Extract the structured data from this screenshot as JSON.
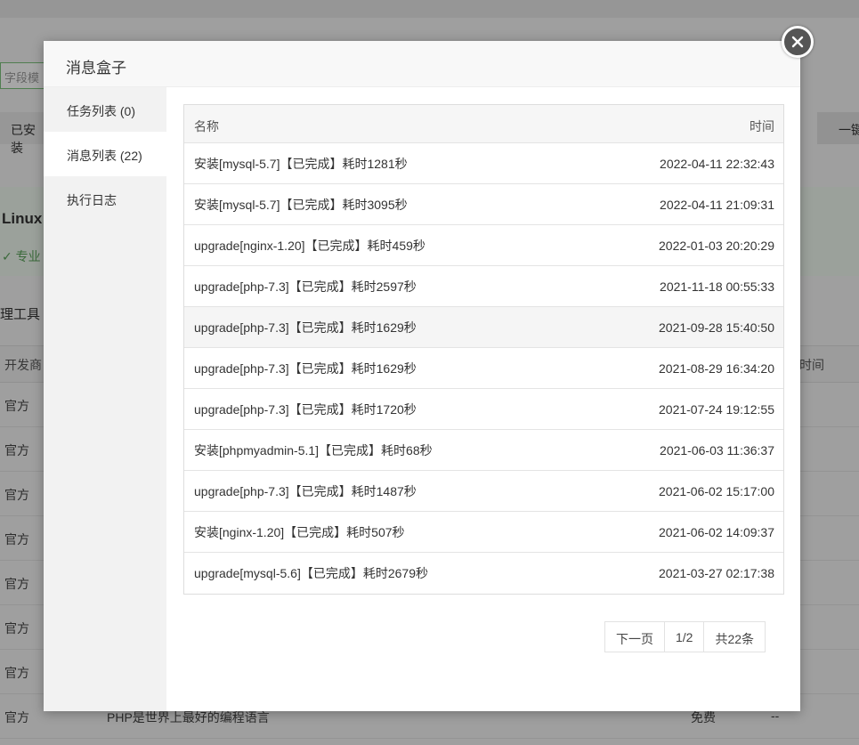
{
  "background": {
    "field_input_placeholder": "字段模",
    "tab_installed": "已安装",
    "onekey_button": "一键",
    "banner_title": "Linux",
    "banner_pro": "✓ 专业",
    "section_title": "理工具",
    "th_vendor": "开发商",
    "th_time": "时间",
    "rows": [
      "官方",
      "官方",
      "官方",
      "官方",
      "官方",
      "官方",
      "官方",
      "官方"
    ],
    "last_row_desc": "PHP是世界上最好的编程语言",
    "last_row_price": "免费",
    "last_row_dash": "--"
  },
  "modal": {
    "title": "消息盒子",
    "sidebar": [
      {
        "label": "任务列表 (0)"
      },
      {
        "label": "消息列表 (22)"
      },
      {
        "label": "执行日志"
      }
    ],
    "table": {
      "col_name": "名称",
      "col_time": "时间",
      "rows": [
        {
          "name": "安装[mysql-5.7]【已完成】耗时1281秒",
          "time": "2022-04-11 22:32:43"
        },
        {
          "name": "安装[mysql-5.7]【已完成】耗时3095秒",
          "time": "2022-04-11 21:09:31"
        },
        {
          "name": "upgrade[nginx-1.20]【已完成】耗时459秒",
          "time": "2022-01-03 20:20:29"
        },
        {
          "name": "upgrade[php-7.3]【已完成】耗时2597秒",
          "time": "2021-11-18 00:55:33"
        },
        {
          "name": "upgrade[php-7.3]【已完成】耗时1629秒",
          "time": "2021-09-28 15:40:50"
        },
        {
          "name": "upgrade[php-7.3]【已完成】耗时1629秒",
          "time": "2021-08-29 16:34:20"
        },
        {
          "name": "upgrade[php-7.3]【已完成】耗时1720秒",
          "time": "2021-07-24 19:12:55"
        },
        {
          "name": "安装[phpmyadmin-5.1]【已完成】耗时68秒",
          "time": "2021-06-03 11:36:37"
        },
        {
          "name": "upgrade[php-7.3]【已完成】耗时1487秒",
          "time": "2021-06-02 15:17:00"
        },
        {
          "name": "安装[nginx-1.20]【已完成】耗时507秒",
          "time": "2021-06-02 14:09:37"
        },
        {
          "name": "upgrade[mysql-5.6]【已完成】耗时2679秒",
          "time": "2021-03-27 02:17:38"
        }
      ]
    },
    "pager": {
      "next": "下一页",
      "page": "1/2",
      "total": "共22条"
    }
  }
}
